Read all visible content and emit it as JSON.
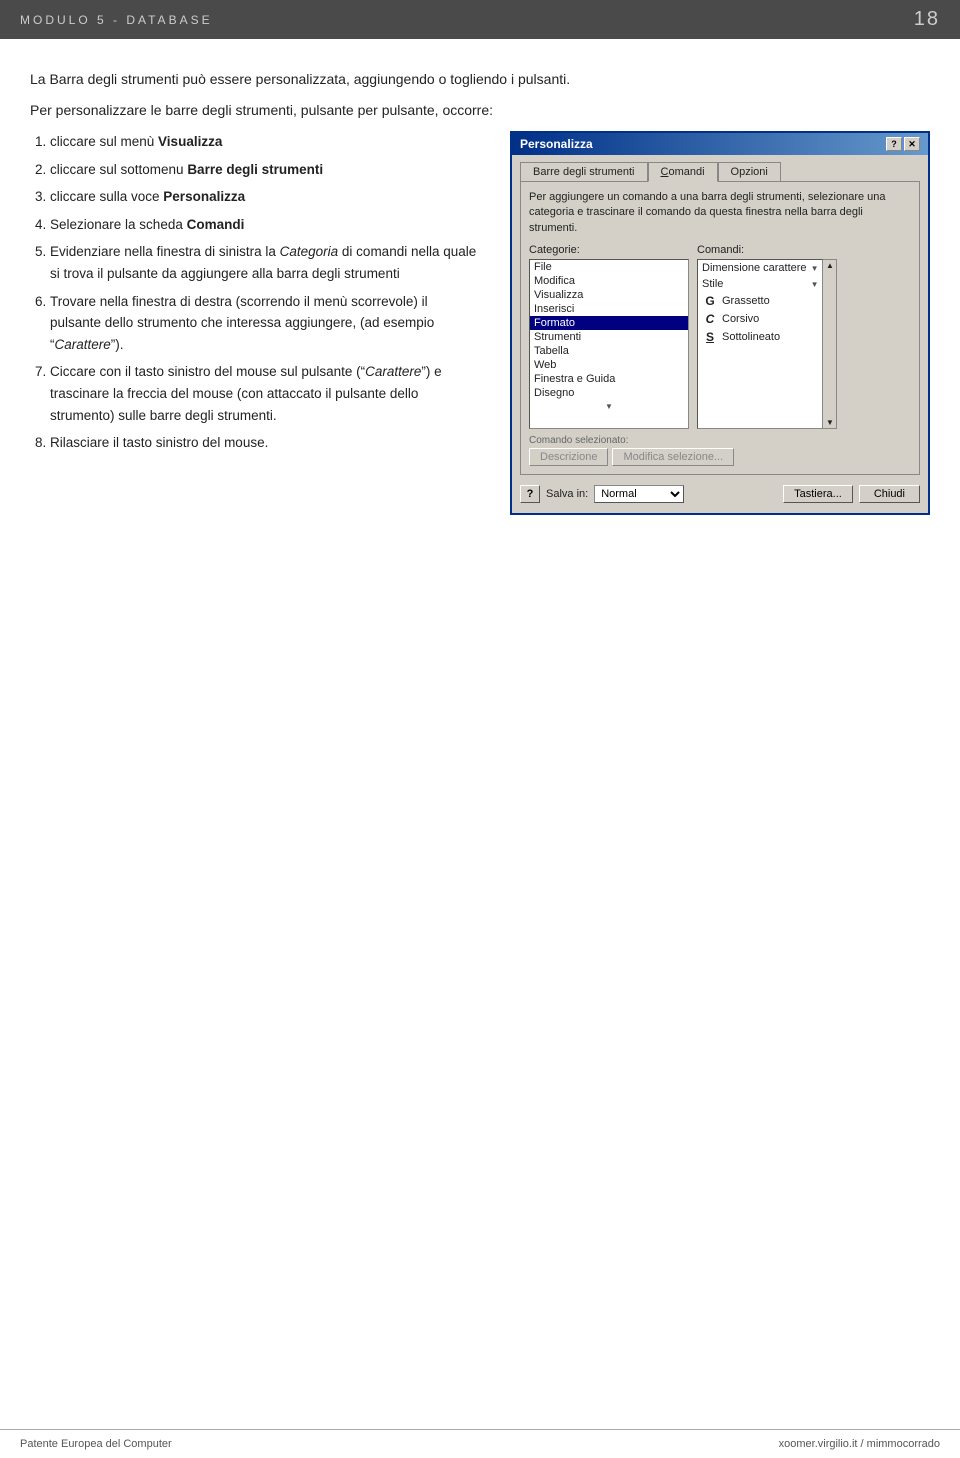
{
  "header": {
    "title": "MODULO 5  -  DATABASE",
    "page_number": "18"
  },
  "intro": {
    "line1": "La Barra degli strumenti può essere personalizzata, aggiungendo o togliendo i pulsanti.",
    "line2": "Per personalizzare le barre degli strumenti, pulsante per pulsante, occorre:"
  },
  "steps": [
    {
      "number": "1",
      "text_plain": "cliccare sul menù ",
      "text_bold": "Visualizza"
    },
    {
      "number": "2",
      "text_plain": "cliccare sul sottomenu ",
      "text_bold": "Barre degli strumenti"
    },
    {
      "number": "3",
      "text_plain": "cliccare sulla voce ",
      "text_bold": "Personalizza"
    },
    {
      "number": "4",
      "text_plain": "Selezionare la scheda ",
      "text_bold": "Comandi"
    },
    {
      "number": "5",
      "text_a": "Evidenziare nella finestra di sinistra la ",
      "text_b_italic": "Categoria",
      "text_c": " di comandi nella quale si trova il pulsante da aggiungere alla barra degli strumenti"
    },
    {
      "number": "6",
      "text_a": "Trovare nella finestra di destra (scorrendo il menù scorrevole) il pulsante dello strumento che interessa aggiungere, (ad esempio “",
      "text_b_italic": "Carattere",
      "text_c": "”)."
    },
    {
      "number": "7",
      "text_a": "Ciccare con il tasto sinistro del mouse sul pulsante (“",
      "text_b_italic": "Carattere",
      "text_c": "”) e trascinare la freccia del mouse (con attaccato il pulsante dello strumento) sulle barre degli strumenti."
    },
    {
      "number": "8",
      "text_plain": "Rilasciare il tasto sinistro del mouse."
    }
  ],
  "dialog": {
    "title": "Personalizza",
    "tabs": [
      "Barre degli strumenti",
      "Comandi",
      "Opzioni"
    ],
    "active_tab": "Comandi",
    "description": "Per aggiungere un comando a una barra degli strumenti, selezionare una categoria e trascinare il comando da questa finestra nella barra degli strumenti.",
    "categories_label": "Categorie:",
    "commands_label": "Comandi:",
    "categories": [
      "File",
      "Modifica",
      "Visualizza",
      "Inserisci",
      "Formato",
      "Strumenti",
      "Tabella",
      "Web",
      "Finestra e Guida",
      "Disegno"
    ],
    "selected_category": "Formato",
    "commands": [
      {
        "label": "Dimensione carattere",
        "has_dropdown": true
      },
      {
        "label": "Stile",
        "has_dropdown": true
      },
      {
        "icon": "G",
        "icon_style": "bold",
        "label": "Grassetto"
      },
      {
        "icon": "C",
        "icon_style": "italic",
        "label": "Corsivo"
      },
      {
        "icon": "S",
        "icon_style": "underline",
        "label": "Sottolineato"
      }
    ],
    "selected_cmd_label": "Comando selezionato:",
    "descrizione_btn": "Descrizione",
    "modifica_btn": "Modifica selezione...",
    "help_symbol": "?",
    "savein_label": "Salva in:",
    "savein_value": "Normal",
    "tastiera_btn": "Tastiera...",
    "chiudi_btn": "Chiudi"
  },
  "footer": {
    "left": "Patente Europea del Computer",
    "right": "xoomer.virgilio.it / mimmocorrado"
  }
}
